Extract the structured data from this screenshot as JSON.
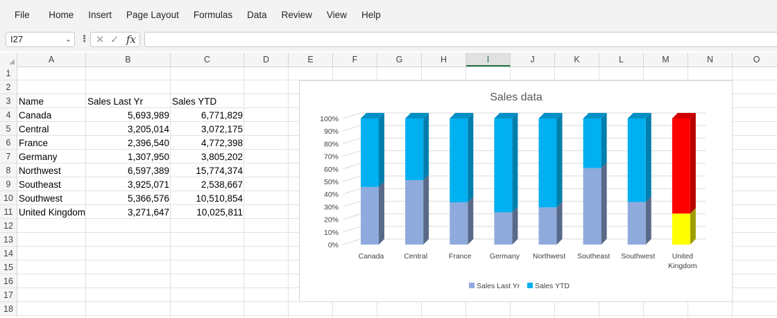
{
  "menu": [
    "File",
    "Home",
    "Insert",
    "Page Layout",
    "Formulas",
    "Data",
    "Review",
    "View",
    "Help"
  ],
  "formula_bar": {
    "name_box": "I27",
    "formula": ""
  },
  "columns": [
    "A",
    "B",
    "C",
    "D",
    "E",
    "F",
    "G",
    "H",
    "I",
    "J",
    "K",
    "L",
    "M",
    "N",
    "O"
  ],
  "selected_column": "I",
  "rows": [
    "1",
    "2",
    "3",
    "4",
    "5",
    "6",
    "7",
    "8",
    "9",
    "10",
    "11",
    "12",
    "13",
    "14",
    "15",
    "16",
    "17",
    "18"
  ],
  "table": {
    "headers": [
      "Name",
      "Sales Last Yr",
      "Sales YTD"
    ],
    "rows": [
      [
        "Canada",
        "5,693,989",
        "6,771,829"
      ],
      [
        "Central",
        "3,205,014",
        "3,072,175"
      ],
      [
        "France",
        "2,396,540",
        "4,772,398"
      ],
      [
        "Germany",
        "1,307,950",
        "3,805,202"
      ],
      [
        "Northwest",
        "6,597,389",
        "15,774,374"
      ],
      [
        "Southeast",
        "3,925,071",
        "2,538,667"
      ],
      [
        "Southwest",
        "5,366,576",
        "10,510,854"
      ],
      [
        "United Kingdom",
        "3,271,647",
        "10,025,811"
      ]
    ]
  },
  "colors": {
    "series1": "#8faadc",
    "series2": "#00b0f0",
    "highlight_low": "#ffff00",
    "highlight_high": "#ff0000"
  },
  "chart_data": {
    "type": "bar",
    "stacked": "percent",
    "title": "Sales data",
    "categories": [
      "Canada",
      "Central",
      "France",
      "Germany",
      "Northwest",
      "Southeast",
      "Southwest",
      "United Kingdom"
    ],
    "series": [
      {
        "name": "Sales Last Yr",
        "values": [
          5693989,
          3205014,
          2396540,
          1307950,
          6597389,
          3925071,
          5366576,
          3271647
        ]
      },
      {
        "name": "Sales YTD",
        "values": [
          6771829,
          3072175,
          4772398,
          3805202,
          15774374,
          2538667,
          10510854,
          10025811
        ]
      }
    ],
    "yticks": [
      "0%",
      "10%",
      "20%",
      "30%",
      "40%",
      "50%",
      "60%",
      "70%",
      "80%",
      "90%",
      "100%"
    ],
    "ylim": [
      0,
      1
    ],
    "legend": "bottom",
    "grid": true,
    "highlighted_category": "United Kingdom"
  }
}
